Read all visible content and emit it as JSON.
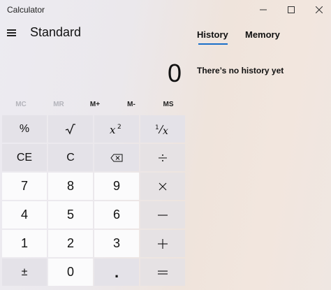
{
  "window": {
    "title": "Calculator"
  },
  "header": {
    "mode": "Standard"
  },
  "display": {
    "value": "0"
  },
  "memory": {
    "buttons": [
      {
        "label": "MC",
        "enabled": false
      },
      {
        "label": "MR",
        "enabled": false
      },
      {
        "label": "M+",
        "enabled": true
      },
      {
        "label": "M-",
        "enabled": true
      },
      {
        "label": "MS",
        "enabled": true
      }
    ]
  },
  "keypad": {
    "percent": "%",
    "ce": "CE",
    "c": "C",
    "n7": "7",
    "n8": "8",
    "n9": "9",
    "n4": "4",
    "n5": "5",
    "n6": "6",
    "n1": "1",
    "n2": "2",
    "n3": "3",
    "negate": "±",
    "n0": "0",
    "decimal": "."
  },
  "panel": {
    "tabs": [
      {
        "label": "History",
        "active": true
      },
      {
        "label": "Memory",
        "active": false
      }
    ],
    "empty_message": "There’s no history yet"
  },
  "colors": {
    "accent": "#1a6fc9"
  },
  "icons": {
    "minimize": "minimize-icon",
    "maximize": "maximize-icon",
    "close": "close-icon",
    "menu": "hamburger-menu-icon",
    "sqrt": "square-root-icon",
    "square": "x-squared-icon",
    "reciprocal": "reciprocal-icon",
    "backspace": "backspace-icon",
    "divide": "divide-icon",
    "multiply": "multiply-icon",
    "minus": "minus-icon",
    "plus": "plus-icon",
    "equals": "equals-icon"
  }
}
